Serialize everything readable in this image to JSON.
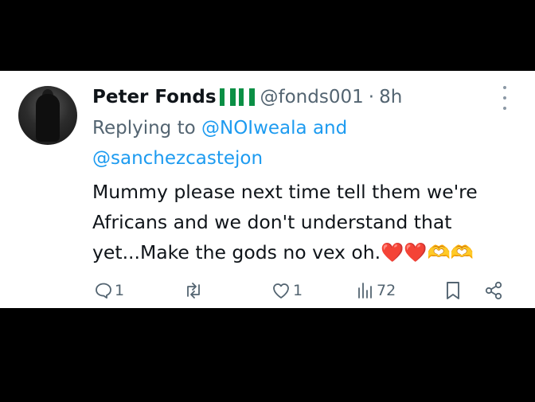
{
  "tweet": {
    "author_name": "Peter Fonds",
    "author_flags": "🇳🇬🇳🇬",
    "handle": "@fonds001",
    "time": "8h",
    "separator": "·",
    "replying_prefix": "Replying to",
    "replying_to_1": "@NOIweala",
    "replying_and": "and",
    "replying_to_2": "@sanchezcastejon",
    "text": "Mummy please next time tell them we're Africans and we don't understand that yet...Make the gods no vex oh.",
    "text_emojis": "❤️❤️🫶🫶"
  },
  "actions": {
    "replies": "1",
    "retweets": "",
    "likes": "1",
    "views": "72"
  },
  "colors": {
    "text": "#0f1419",
    "muted": "#536471",
    "link": "#1d9bf0",
    "flag_green": "#0a8f45",
    "heart": "#e0245e",
    "heart_hands": "#f5b400"
  }
}
